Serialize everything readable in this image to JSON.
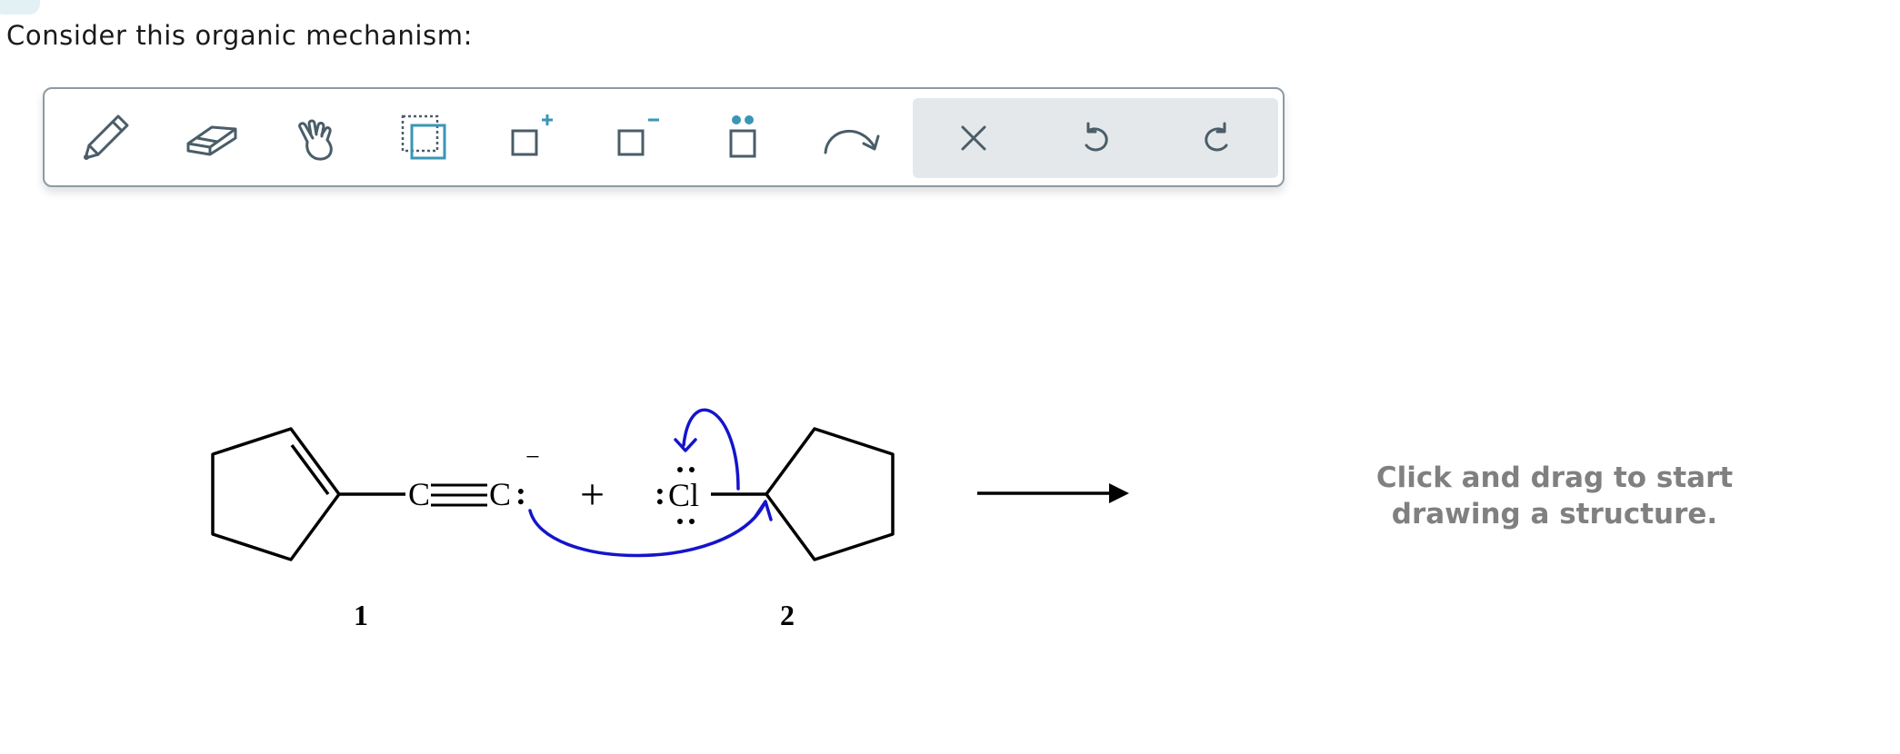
{
  "prompt": "Consider this organic mechanism:",
  "toolbar": {
    "tools": [
      {
        "id": "pencil",
        "icon": "pencil-icon"
      },
      {
        "id": "eraser",
        "icon": "eraser-icon"
      },
      {
        "id": "hand",
        "icon": "hand-pointer-icon"
      },
      {
        "id": "select",
        "icon": "lasso-select-icon"
      },
      {
        "id": "charge-plus",
        "icon": "positive-charge-icon",
        "glyph": "+"
      },
      {
        "id": "charge-minus",
        "icon": "negative-charge-icon",
        "glyph": "−"
      },
      {
        "id": "lone-pair",
        "icon": "lone-pair-icon"
      },
      {
        "id": "curved-arrow",
        "icon": "curved-arrow-icon"
      }
    ],
    "actions": [
      {
        "id": "clear",
        "icon": "close-icon"
      },
      {
        "id": "undo",
        "icon": "undo-icon"
      },
      {
        "id": "redo",
        "icon": "redo-icon"
      }
    ],
    "accent_color": "#3a96b5",
    "icon_color": "#4a5d68"
  },
  "mechanism": {
    "reactant1": {
      "label": "1",
      "atom_left": "C",
      "atom_right": "C",
      "lone_pair": ":",
      "charge": "−"
    },
    "plus": "+",
    "reactant2": {
      "label": "2",
      "halogen": "Cl",
      "lone_pair_left": ":"
    },
    "arrow_color": "#1414cc"
  },
  "canvas": {
    "hint_line1": "Click and drag to start",
    "hint_line2": "drawing a structure."
  }
}
